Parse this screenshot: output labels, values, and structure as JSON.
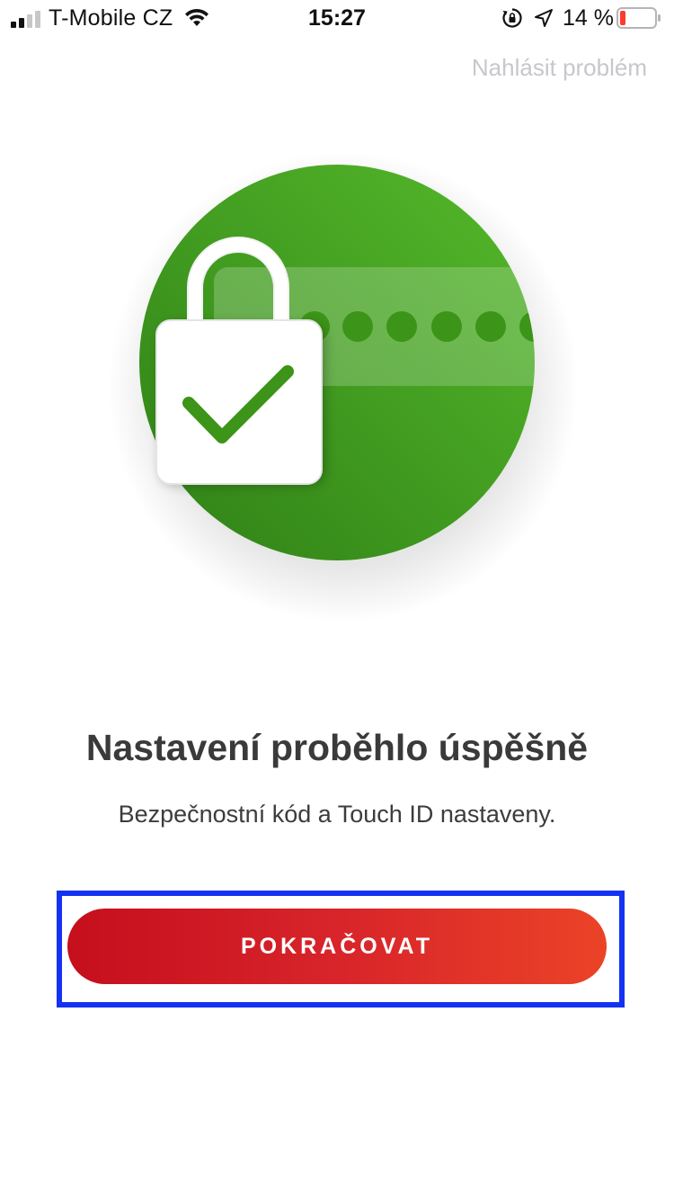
{
  "status_bar": {
    "carrier": "T-Mobile CZ",
    "time": "15:27",
    "battery_percent": "14 %",
    "battery_color": "#ff3b30"
  },
  "header": {
    "report_problem_label": "Nahlásit problém"
  },
  "illustration": {
    "icon": "padlock-check-icon",
    "circle_color": "#3e9a1f",
    "dots_count_visible": 6
  },
  "main": {
    "title": "Nastavení proběhlo úspěšně",
    "subtitle": "Bezpečnostní kód a Touch ID nastaveny."
  },
  "actions": {
    "continue_label": "POKRAČOVAT",
    "continue_gradient": [
      "#c50f1d",
      "#eb4327"
    ]
  }
}
